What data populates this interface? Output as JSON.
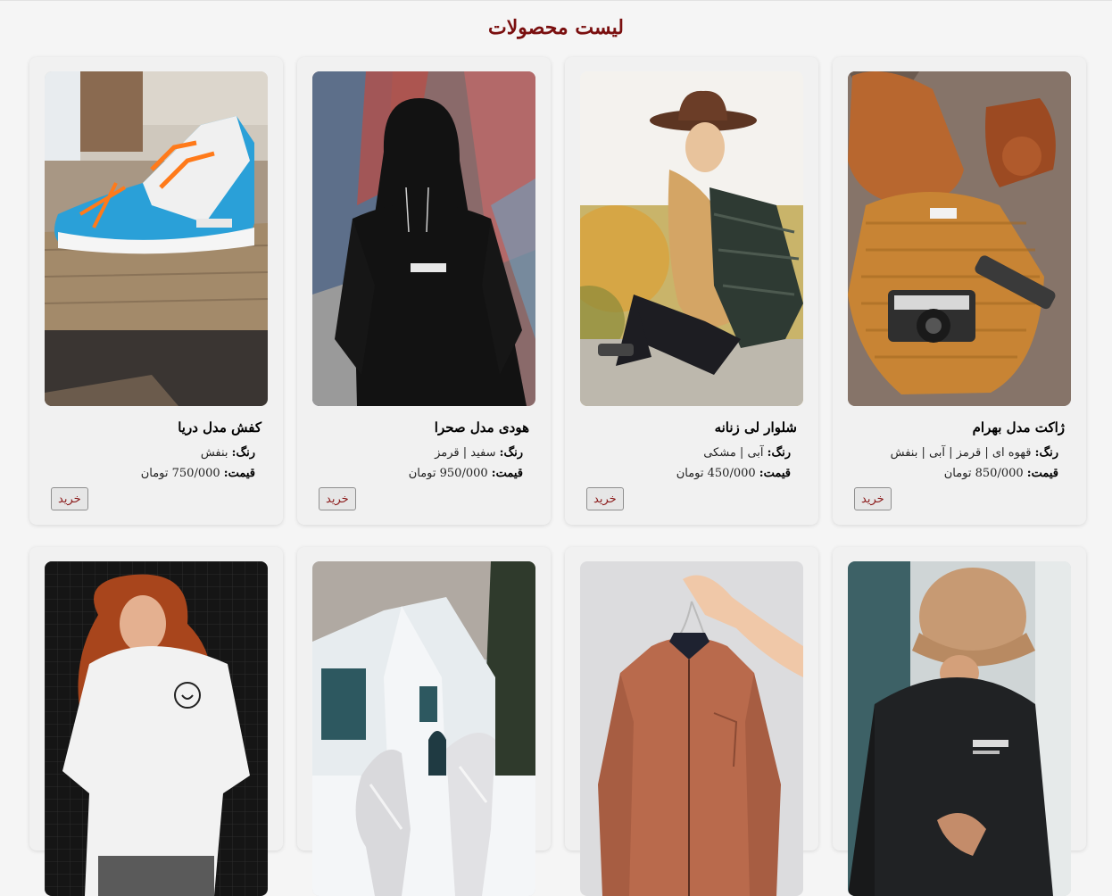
{
  "page": {
    "title": "لیست محصولات"
  },
  "labels": {
    "color": "رنگ:",
    "price": "قیمت:",
    "buy": "خرید"
  },
  "products": [
    {
      "name": "ژاکت مدل بهرام",
      "colors": "قهوه ای | قرمز | آبی | بنفش",
      "price": "850/000 تومان",
      "image": "sweater-camera-photo"
    },
    {
      "name": "شلوار لی زنانه",
      "colors": "آبی | مشکی",
      "price": "450/000 تومان",
      "image": "woman-hat-jeans-photo"
    },
    {
      "name": "هودی مدل صحرا",
      "colors": "سفید | قرمز",
      "price": "950/000 تومان",
      "image": "black-hoodie-photo"
    },
    {
      "name": "کفش مدل دریا",
      "colors": "بنفش",
      "price": "750/000 تومان",
      "image": "blue-sneaker-photo"
    },
    {
      "image": "bucket-hat-man-photo"
    },
    {
      "image": "copper-bomber-jacket-photo"
    },
    {
      "image": "silver-heels-photo"
    },
    {
      "image": "white-tshirt-woman-photo"
    }
  ]
}
